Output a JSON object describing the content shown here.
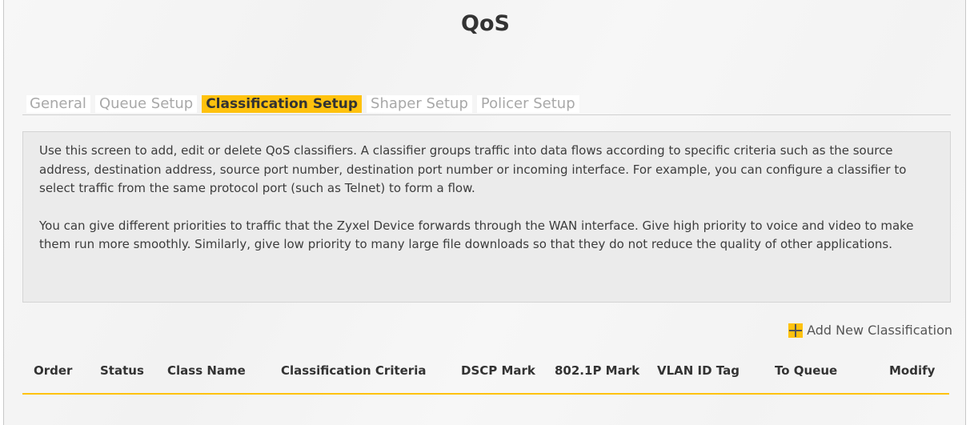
{
  "page": {
    "title": "QoS"
  },
  "tabs": [
    {
      "label": "General",
      "active": false
    },
    {
      "label": "Queue Setup",
      "active": false
    },
    {
      "label": "Classification Setup",
      "active": true
    },
    {
      "label": "Shaper Setup",
      "active": false
    },
    {
      "label": "Policer Setup",
      "active": false
    }
  ],
  "info": {
    "paragraph1": "Use this screen to add, edit or delete QoS classifiers. A classifier groups traffic into data flows according to specific criteria such as the source address, destination address, source port number, destination port number or incoming interface. For example, you can configure a classifier to select traffic from the same protocol port (such as Telnet) to form a flow.",
    "paragraph2": "You can give different priorities to traffic that the Zyxel Device forwards through the WAN interface. Give high priority to voice and video to make them run more smoothly. Similarly, give low priority to many large file downloads so that they do not reduce the quality of other applications."
  },
  "actions": {
    "add_new_label": "Add New Classification",
    "add_icon": "plus-icon"
  },
  "table": {
    "columns": [
      "Order",
      "Status",
      "Class Name",
      "Classification Criteria",
      "DSCP Mark",
      "802.1P Mark",
      "VLAN ID Tag",
      "To Queue",
      "Modify"
    ],
    "rows": []
  },
  "colors": {
    "accent": "#ffc20e",
    "info_bg": "#ebebeb",
    "text": "#333333",
    "tab_inactive": "#a8a8a8"
  }
}
